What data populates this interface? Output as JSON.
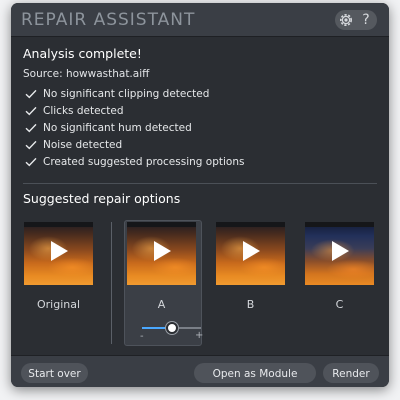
{
  "window": {
    "title": "REPAIR ASSISTANT",
    "help_label": "?"
  },
  "analysis": {
    "heading": "Analysis complete!",
    "source_label": "Source:",
    "source_file": "howwasthat.aiff",
    "results": [
      "No significant clipping detected",
      "Clicks detected",
      "No significant hum detected",
      "Noise detected",
      "Created suggested processing options"
    ]
  },
  "suggestions": {
    "heading": "Suggested repair options",
    "options": [
      {
        "label": "Original",
        "selected": false
      },
      {
        "label": "A",
        "selected": true
      },
      {
        "label": "B",
        "selected": false
      },
      {
        "label": "C",
        "selected": false
      }
    ],
    "intensity": {
      "minus_label": "-",
      "plus_label": "+",
      "value_fraction": 0.5
    }
  },
  "footer": {
    "start_over_label": "Start over",
    "module_chain_label": "Open as Module Chain",
    "render_label": "Render"
  },
  "colors": {
    "accent": "#4aa8ff",
    "window_bg": "#2b2e33",
    "bar_bg": "#3a3e45"
  }
}
